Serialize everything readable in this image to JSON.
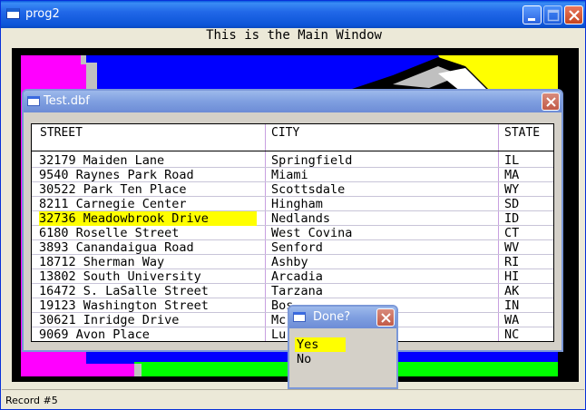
{
  "main_window": {
    "title": "prog2",
    "caption": "This is the Main Window"
  },
  "status": {
    "text": "Record #5"
  },
  "table_window": {
    "title": "Test.dbf",
    "columns": [
      "STREET",
      "CITY",
      "STATE"
    ],
    "selected_row": 5,
    "rows": [
      [
        "32179 Maiden Lane",
        "Springfield",
        "IL"
      ],
      [
        "9540 Raynes Park Road",
        "Miami",
        "MA"
      ],
      [
        "30522 Park Ten Place",
        "Scottsdale",
        "WY"
      ],
      [
        "8211 Carnegie Center",
        "Hingham",
        "SD"
      ],
      [
        "32736 Meadowbrook Drive",
        "Nedlands",
        "ID"
      ],
      [
        "6180 Roselle Street",
        "West Covina",
        "CT"
      ],
      [
        "3893 Canandaigua Road",
        "Senford",
        "WV"
      ],
      [
        "18712 Sherman Way",
        "Ashby",
        "RI"
      ],
      [
        "13802 South University",
        "Arcadia",
        "HI"
      ],
      [
        "16472 S. LaSalle Street",
        "Tarzana",
        "AK"
      ],
      [
        "19123 Washington Street",
        "Bos",
        "IN"
      ],
      [
        "30621 Inridge Drive",
        "Mc",
        "WA"
      ],
      [
        "9069 Avon Place",
        "Lu",
        "NC"
      ]
    ]
  },
  "dialog": {
    "title": "Done?",
    "options": [
      "Yes",
      "No"
    ],
    "selected": 0
  },
  "colors": {
    "highlight": "#ffff00",
    "canvas_magenta": "#ff00ff",
    "canvas_blue": "#0000ff",
    "canvas_yellow": "#ffff00",
    "canvas_green": "#00ff00"
  },
  "icons": {
    "minimize": "minimize-icon",
    "maximize": "maximize-icon",
    "close": "close-icon",
    "window": "window-icon"
  }
}
